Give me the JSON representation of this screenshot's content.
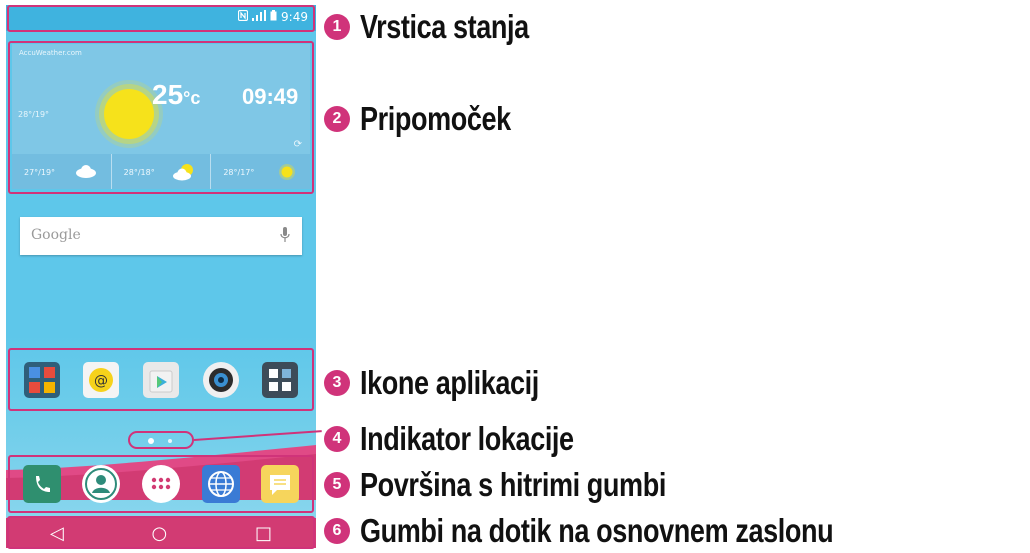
{
  "status_bar": {
    "nfc_icon": "nfc-icon",
    "signal_icon": "signal-icon",
    "battery_icon": "battery-icon",
    "time": "9:49"
  },
  "widget": {
    "brand": "AccuWeather.com",
    "temperature": "25",
    "unit": "°c",
    "time": "09:49",
    "range": "28°/19°",
    "forecast": [
      {
        "range": "27°/19°",
        "icon": "cloud-icon"
      },
      {
        "range": "28°/18°",
        "icon": "sun-cloud-icon"
      },
      {
        "range": "28°/17°",
        "icon": "sun-icon"
      }
    ]
  },
  "search": {
    "placeholder": "Google"
  },
  "apps": [
    {
      "name": "google-folder-app"
    },
    {
      "name": "email-app"
    },
    {
      "name": "play-store-app"
    },
    {
      "name": "camera-app"
    },
    {
      "name": "tools-folder-app"
    }
  ],
  "dock": [
    {
      "name": "phone-app"
    },
    {
      "name": "contacts-app"
    },
    {
      "name": "app-drawer"
    },
    {
      "name": "browser-app"
    },
    {
      "name": "messaging-app"
    }
  ],
  "navbar": {
    "back": "◁",
    "home": "○",
    "recent": "□"
  },
  "callouts": [
    {
      "number": "1",
      "label": "Vrstica stanja"
    },
    {
      "number": "2",
      "label": "Pripomoček"
    },
    {
      "number": "3",
      "label": "Ikone aplikacij"
    },
    {
      "number": "4",
      "label": "Indikator lokacije"
    },
    {
      "number": "5",
      "label": "Površina s hitrimi gumbi"
    },
    {
      "number": "6",
      "label": "Gumbi na dotik na osnovnem zaslonu"
    }
  ],
  "colors": {
    "accent": "#d0337a",
    "wallpaper": "#5ec7ea",
    "statusbar": "#3fb3df"
  }
}
